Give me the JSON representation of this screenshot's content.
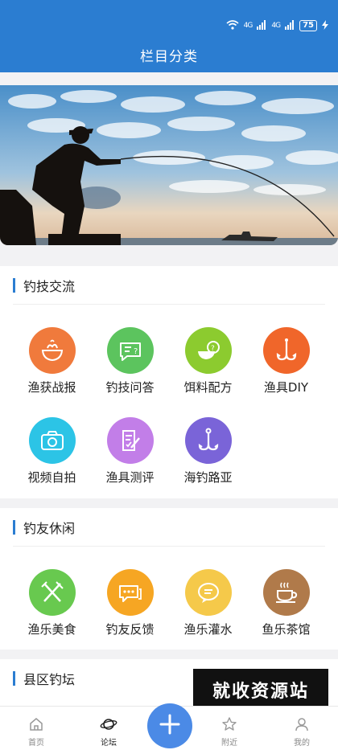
{
  "status": {
    "network1": "4G",
    "network2": "4G",
    "battery": "75"
  },
  "header": {
    "title": "栏目分类"
  },
  "sections": [
    {
      "title": "钓技交流",
      "items": [
        {
          "label": "渔获战报",
          "icon": "bowl-icon",
          "color": "#f07a3c"
        },
        {
          "label": "钓技问答",
          "icon": "chat-question-icon",
          "color": "#5cc45e"
        },
        {
          "label": "饵料配方",
          "icon": "bait-bowl-icon",
          "color": "#8ccb2f"
        },
        {
          "label": "渔具DIY",
          "icon": "fish-hook-icon",
          "color": "#f0662a"
        },
        {
          "label": "视频自拍",
          "icon": "camera-icon",
          "color": "#2cc4e6"
        },
        {
          "label": "渔具测评",
          "icon": "review-icon",
          "color": "#c27ee8"
        },
        {
          "label": "海钓路亚",
          "icon": "lure-hook-icon",
          "color": "#7a64d8"
        }
      ]
    },
    {
      "title": "钓友休闲",
      "items": [
        {
          "label": "渔乐美食",
          "icon": "cutlery-icon",
          "color": "#68c94f"
        },
        {
          "label": "钓友反馈",
          "icon": "feedback-icon",
          "color": "#f6a623"
        },
        {
          "label": "渔乐灌水",
          "icon": "chat-bubble-icon",
          "color": "#f5c94a"
        },
        {
          "label": "鱼乐茶馆",
          "icon": "tea-cup-icon",
          "color": "#b07a4a"
        }
      ]
    },
    {
      "title": "县区钓坛",
      "items": []
    }
  ],
  "watermark": "就收资源站",
  "tabs": [
    {
      "label": "首页",
      "icon": "home-icon"
    },
    {
      "label": "论坛",
      "icon": "planet-icon"
    },
    {
      "label": "",
      "icon": "plus-icon"
    },
    {
      "label": "附近",
      "icon": "star-icon"
    },
    {
      "label": "我的",
      "icon": "user-icon"
    }
  ]
}
